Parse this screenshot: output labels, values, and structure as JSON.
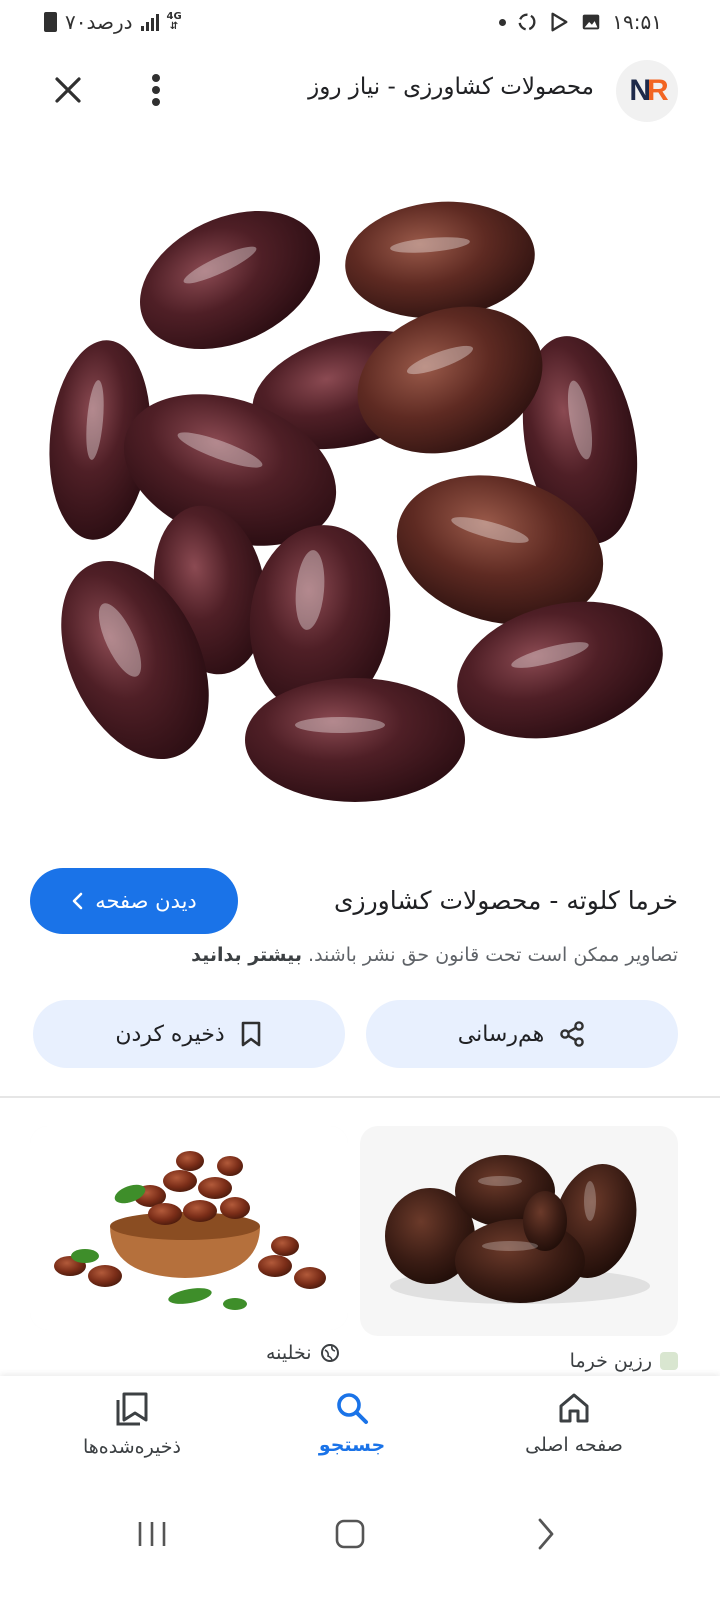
{
  "status_bar": {
    "time": "۱۹:۵۱",
    "battery": "۷۰درصد",
    "network": "4G"
  },
  "header": {
    "site_title": "محصولات کشاورزی - نیاز روز",
    "logo_text_1": "N",
    "logo_text_2": "R",
    "icons": [
      "close-icon",
      "more-vert-icon"
    ]
  },
  "result": {
    "title": "خرما کلوته - محصولات کشاورزی",
    "view_page_label": "دیدن صفحه",
    "copyright_text": "تصاویر ممکن است تحت قانون حق نشر باشند.",
    "learn_more": "بیشتر بدانید"
  },
  "actions": {
    "share_label": "هم‌رسانی",
    "save_label": "ذخیره کردن"
  },
  "related": [
    {
      "source": "رزین خرما"
    },
    {
      "source": "نخلینه"
    }
  ],
  "bottom_nav": {
    "home_label": "صفحه اصلی",
    "search_label": "جستجو",
    "saved_label": "ذخیره‌شده‌ها"
  },
  "colors": {
    "accent": "#1a73e8",
    "chip_bg": "#e8f0fe",
    "logo_orange": "#f26522",
    "logo_navy": "#1e2a4a"
  }
}
